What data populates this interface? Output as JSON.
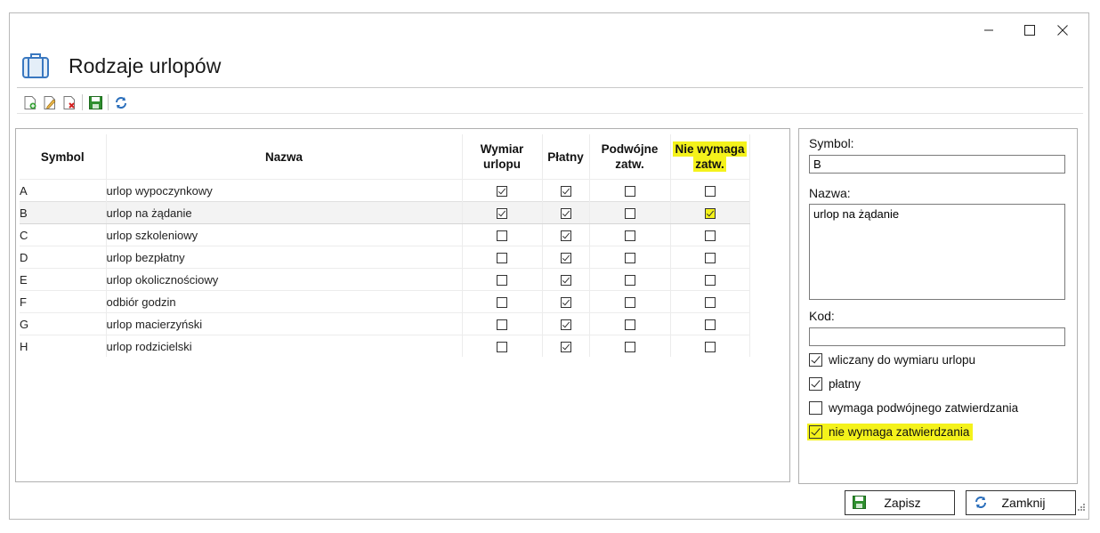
{
  "window": {
    "title": "Rodzaje urlopów",
    "controls": {
      "minimize": "minimize",
      "maximize": "maximize",
      "close": "close"
    }
  },
  "toolbar": {
    "items": [
      {
        "icon": "new-document-icon"
      },
      {
        "icon": "edit-document-icon"
      },
      {
        "icon": "delete-document-icon"
      },
      {
        "icon": "save-icon"
      },
      {
        "icon": "refresh-icon"
      }
    ]
  },
  "grid": {
    "columns": {
      "symbol": "Symbol",
      "nazwa": "Nazwa",
      "wymiar_1": "Wymiar",
      "wymiar_2": "urlopu",
      "platny": "Płatny",
      "podwojne_1": "Podwójne",
      "podwojne_2": "zatw.",
      "nie_wymaga_1": "Nie wymaga",
      "nie_wymaga_2": "zatw."
    },
    "rows": [
      {
        "symbol": "A",
        "nazwa": "urlop wypoczynkowy",
        "wymiar": true,
        "platny": true,
        "podwojne": false,
        "nie_wymaga": false
      },
      {
        "symbol": "B",
        "nazwa": "urlop na żądanie",
        "wymiar": true,
        "platny": true,
        "podwojne": false,
        "nie_wymaga": true
      },
      {
        "symbol": "C",
        "nazwa": "urlop szkoleniowy",
        "wymiar": false,
        "platny": true,
        "podwojne": false,
        "nie_wymaga": false
      },
      {
        "symbol": "D",
        "nazwa": "urlop bezpłatny",
        "wymiar": false,
        "platny": true,
        "podwojne": false,
        "nie_wymaga": false
      },
      {
        "symbol": "E",
        "nazwa": "urlop okolicznościowy",
        "wymiar": false,
        "platny": true,
        "podwojne": false,
        "nie_wymaga": false
      },
      {
        "symbol": "F",
        "nazwa": "odbiór godzin",
        "wymiar": false,
        "platny": true,
        "podwojne": false,
        "nie_wymaga": false
      },
      {
        "symbol": "G",
        "nazwa": "urlop macierzyński",
        "wymiar": false,
        "platny": true,
        "podwojne": false,
        "nie_wymaga": false
      },
      {
        "symbol": "H",
        "nazwa": "urlop rodzicielski",
        "wymiar": false,
        "platny": true,
        "podwojne": false,
        "nie_wymaga": false
      }
    ]
  },
  "form": {
    "symbol_label": "Symbol:",
    "symbol_value": "B",
    "nazwa_label": "Nazwa:",
    "nazwa_value": "urlop na żądanie",
    "kod_label": "Kod:",
    "kod_value": "",
    "checks": [
      {
        "label": "wliczany do wymiaru urlopu",
        "checked": true
      },
      {
        "label": "płatny",
        "checked": true
      },
      {
        "label": "wymaga podwójnego zatwierdzania",
        "checked": false
      },
      {
        "label": "nie wymaga zatwierdzania",
        "checked": true
      }
    ]
  },
  "buttons": {
    "save": "Zapisz",
    "close": "Zamknij"
  },
  "colors": {
    "highlight": "#f4f21b",
    "selected_row": "#f3f3f3"
  }
}
